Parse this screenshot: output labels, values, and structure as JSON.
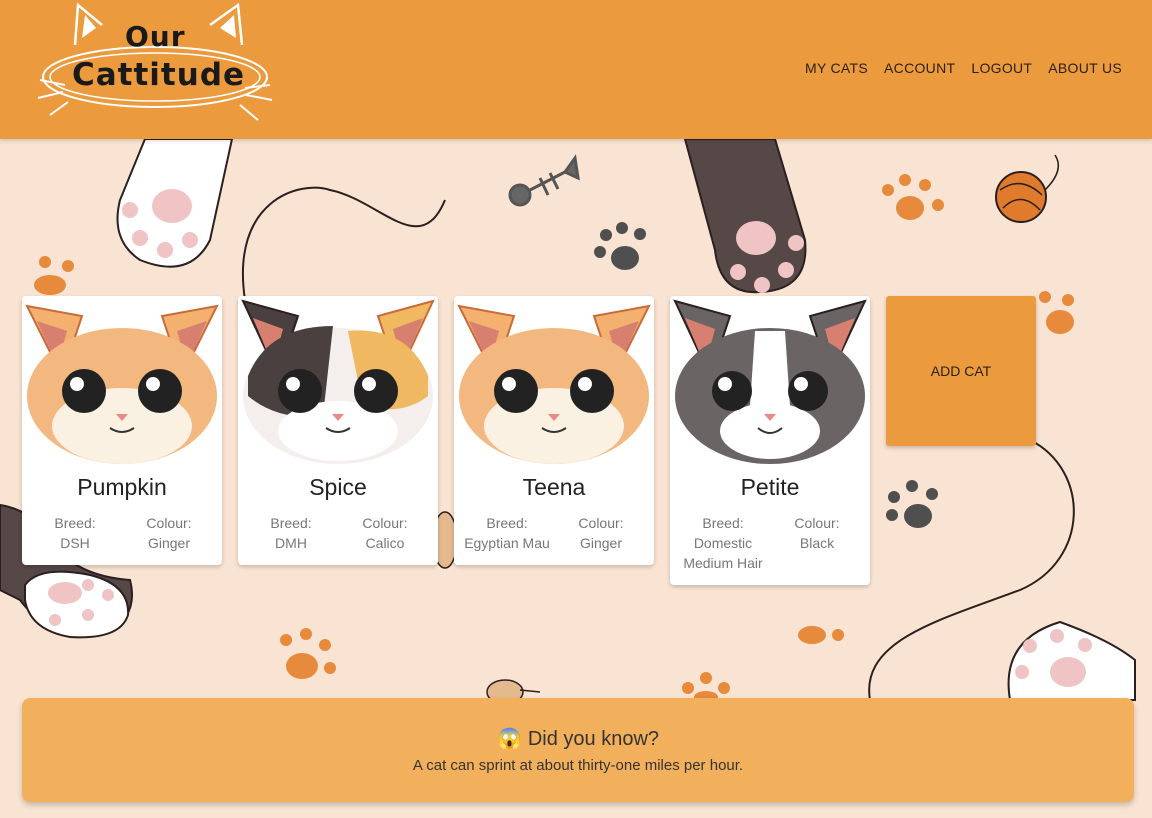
{
  "header": {
    "logo": {
      "line1": "Our",
      "line2": "Cattitude"
    },
    "nav": [
      {
        "label": "MY CATS"
      },
      {
        "label": "ACCOUNT"
      },
      {
        "label": "LOGOUT"
      },
      {
        "label": "ABOUT US"
      }
    ]
  },
  "cats": [
    {
      "name": "Pumpkin",
      "breed_label": "Breed:",
      "breed": "DSH",
      "colour_label": "Colour:",
      "colour": "Ginger"
    },
    {
      "name": "Spice",
      "breed_label": "Breed:",
      "breed": "DMH",
      "colour_label": "Colour:",
      "colour": "Calico"
    },
    {
      "name": "Teena",
      "breed_label": "Breed:",
      "breed": "Egyptian Mau",
      "colour_label": "Colour:",
      "colour": "Ginger"
    },
    {
      "name": "Petite",
      "breed_label": "Breed:",
      "breed": "Domestic Medium Hair",
      "colour_label": "Colour:",
      "colour": "Black"
    }
  ],
  "add_cat": {
    "label": "ADD CAT"
  },
  "fact": {
    "icon": "shocked-face-icon",
    "title": "Did you know?",
    "body": "A cat can sprint at about thirty-one miles per hour."
  },
  "colors": {
    "header": "#ec9a3e",
    "background": "#f9e3d2",
    "fact_panel": "#f3b05c"
  }
}
